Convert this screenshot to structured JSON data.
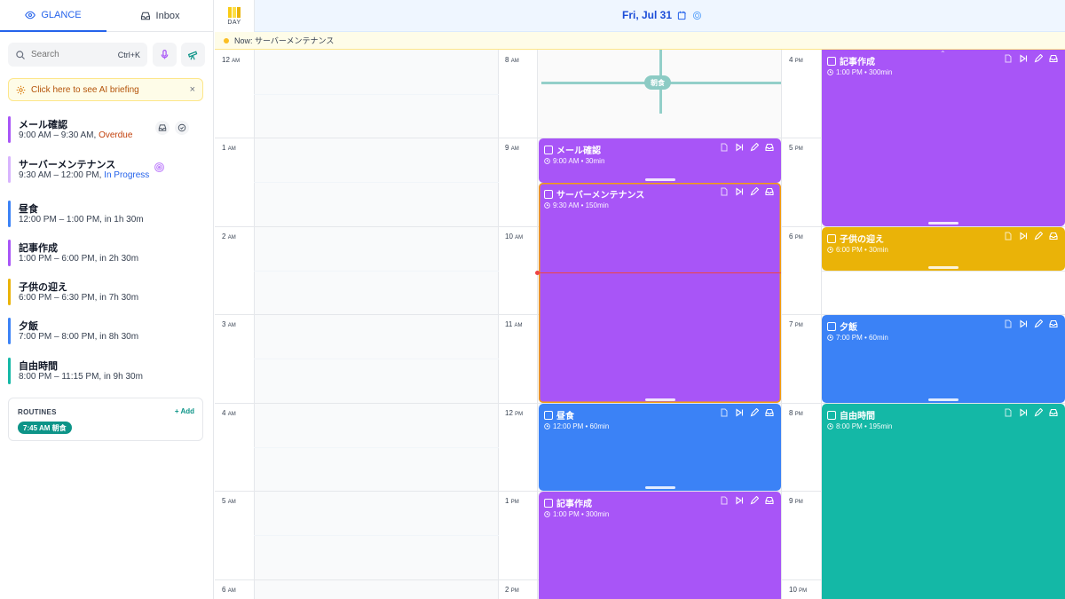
{
  "sidebar": {
    "tabs": [
      {
        "label": "GLANCE",
        "icon": "eye-icon",
        "active": true
      },
      {
        "label": "Inbox",
        "icon": "inbox-icon",
        "active": false
      }
    ],
    "search": {
      "placeholder": "Search",
      "shortcut": "Ctrl+K"
    },
    "buttons": {
      "mic": "microphone-icon",
      "telescope": "telescope-icon"
    },
    "briefing": {
      "text": "Click here to see AI briefing",
      "close": "×"
    },
    "tasks": [
      {
        "title": "メール確認",
        "time": "9:00 AM – 9:30 AM, ",
        "status": "Overdue",
        "status_kind": "overdue",
        "color": "#a855f7"
      },
      {
        "title": "サーバーメンテナンス",
        "time": "9:30 AM – 12:00 PM, ",
        "status": "In Progress",
        "status_kind": "progress",
        "color": "#d8b4fe"
      },
      {
        "title": "昼食",
        "time": "12:00 PM – 1:00 PM, in 1h 30m",
        "status": "",
        "color": "#3b82f6"
      },
      {
        "title": "記事作成",
        "time": "1:00 PM – 6:00 PM, in 2h 30m",
        "status": "",
        "color": "#a855f7"
      },
      {
        "title": "子供の迎え",
        "time": "6:00 PM – 6:30 PM, in 7h 30m",
        "status": "",
        "color": "#eab308"
      },
      {
        "title": "夕飯",
        "time": "7:00 PM – 8:00 PM, in 8h 30m",
        "status": "",
        "color": "#3b82f6"
      },
      {
        "title": "自由時間",
        "time": "8:00 PM – 11:15 PM, in 9h 30m",
        "status": "",
        "color": "#14b8a6"
      }
    ],
    "routines": {
      "label": "ROUTINES",
      "add": "+ Add",
      "items": [
        {
          "time": "7:45 AM",
          "name": "朝食"
        }
      ]
    }
  },
  "header": {
    "view_label": "DAY",
    "date": "Fri, Jul 31"
  },
  "now_bar": {
    "text": "Now: サーバーメンテナンス"
  },
  "hours": {
    "col1": [
      {
        "n": "12",
        "p": "AM"
      },
      {
        "n": "1",
        "p": "AM"
      },
      {
        "n": "2",
        "p": "AM"
      },
      {
        "n": "3",
        "p": "AM"
      },
      {
        "n": "4",
        "p": "AM"
      },
      {
        "n": "5",
        "p": "AM"
      },
      {
        "n": "6",
        "p": "AM"
      }
    ],
    "col2": [
      {
        "n": "8",
        "p": "AM"
      },
      {
        "n": "9",
        "p": "AM"
      },
      {
        "n": "10",
        "p": "AM"
      },
      {
        "n": "11",
        "p": "AM"
      },
      {
        "n": "12",
        "p": "PM"
      },
      {
        "n": "1",
        "p": "PM"
      },
      {
        "n": "2",
        "p": "PM"
      }
    ],
    "col3": [
      {
        "n": "4",
        "p": "PM"
      },
      {
        "n": "5",
        "p": "PM"
      },
      {
        "n": "6",
        "p": "PM"
      },
      {
        "n": "7",
        "p": "PM"
      },
      {
        "n": "8",
        "p": "PM"
      },
      {
        "n": "9",
        "p": "PM"
      },
      {
        "n": "10",
        "p": "PM"
      }
    ]
  },
  "routine_marker": {
    "label": "朝食"
  },
  "events": {
    "mail": {
      "title": "メール確認",
      "meta": "9:00 AM • 30min",
      "color": "#a855f7"
    },
    "server": {
      "title": "サーバーメンテナンス",
      "meta": "9:30 AM • 150min",
      "color": "#a855f7"
    },
    "lunch": {
      "title": "昼食",
      "meta": "12:00 PM • 60min",
      "color": "#3b82f6"
    },
    "article_a": {
      "title": "記事作成",
      "meta": "1:00 PM • 300min",
      "color": "#a855f7"
    },
    "article_b": {
      "title": "記事作成",
      "meta": "1:00 PM • 300min",
      "color": "#a855f7"
    },
    "pickup": {
      "title": "子供の迎え",
      "meta": "6:00 PM • 30min",
      "color": "#eab308"
    },
    "dinner": {
      "title": "夕飯",
      "meta": "7:00 PM • 60min",
      "color": "#3b82f6"
    },
    "free": {
      "title": "自由時間",
      "meta": "8:00 PM • 195min",
      "color": "#14b8a6"
    }
  }
}
